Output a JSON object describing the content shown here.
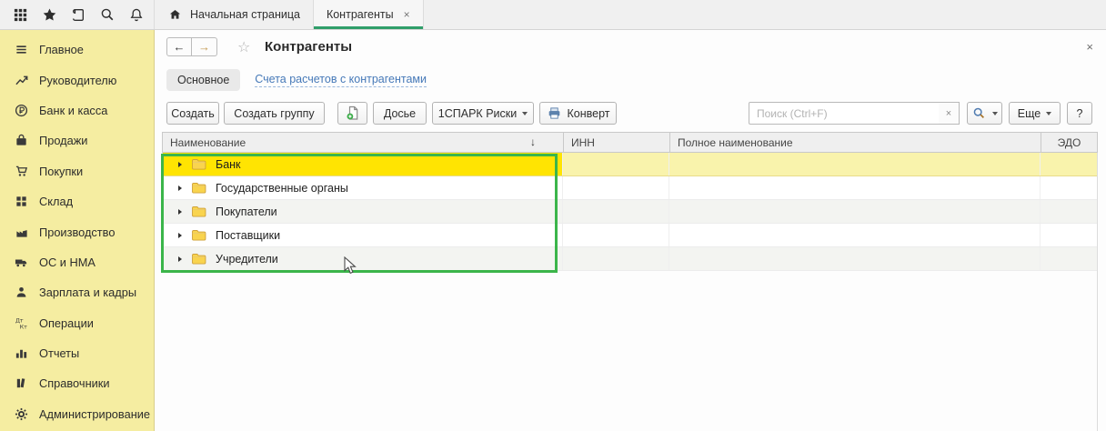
{
  "topbar": {
    "icons": [
      {
        "name": "apps-grid-icon"
      },
      {
        "name": "favorites-star-icon"
      },
      {
        "name": "history-icon"
      },
      {
        "name": "search-icon"
      },
      {
        "name": "notifications-bell-icon"
      }
    ],
    "tabs": [
      {
        "label": "Начальная страница",
        "icon": "home-icon",
        "active": false
      },
      {
        "label": "Контрагенты",
        "close": "×",
        "active": true
      }
    ]
  },
  "sidebar": {
    "items": [
      {
        "icon": "menu-icon",
        "label": "Главное"
      },
      {
        "icon": "trend-icon",
        "label": "Руководителю"
      },
      {
        "icon": "ruble-icon",
        "label": "Банк и касса"
      },
      {
        "icon": "bag-icon",
        "label": "Продажи"
      },
      {
        "icon": "cart-icon",
        "label": "Покупки"
      },
      {
        "icon": "boxes-icon",
        "label": "Склад"
      },
      {
        "icon": "factory-icon",
        "label": "Производство"
      },
      {
        "icon": "truck-icon",
        "label": "ОС и НМА"
      },
      {
        "icon": "person-icon",
        "label": "Зарплата и кадры"
      },
      {
        "icon": "dtkt-icon",
        "label": "Операции"
      },
      {
        "icon": "chart-icon",
        "label": "Отчеты"
      },
      {
        "icon": "books-icon",
        "label": "Справочники"
      },
      {
        "icon": "gear-icon",
        "label": "Администрирование"
      }
    ]
  },
  "form": {
    "back": "←",
    "forward": "→",
    "star": "☆",
    "title": "Контрагенты",
    "close": "×",
    "views": {
      "active": "Основное",
      "link": "Счета расчетов с контрагентами"
    },
    "toolbar": {
      "create": "Создать",
      "create_group": "Создать группу",
      "dossier": "Досье",
      "spark": "1СПАРК Риски",
      "envelope": "Конверт",
      "more": "Еще",
      "help": "?",
      "search_placeholder": "Поиск (Ctrl+F)",
      "search_value": "",
      "clear": "×"
    },
    "table": {
      "columns": [
        "Наименование",
        "ИНН",
        "Полное наименование",
        "ЭДО"
      ],
      "sort_indicator": "↓",
      "rows": [
        {
          "name": "Банк",
          "selected": true
        },
        {
          "name": "Государственные органы",
          "selected": false
        },
        {
          "name": "Покупатели",
          "selected": false
        },
        {
          "name": "Поставщики",
          "selected": false
        },
        {
          "name": "Учредители",
          "selected": false
        }
      ]
    }
  },
  "colors": {
    "active_tab_underline": "#2f9e69",
    "annotation_box": "#3bb54a",
    "selected_cell": "#ffe402",
    "selected_row": "#f9f3ac",
    "sidebar_bg": "#f5eda1",
    "link_blue": "#4679b8"
  }
}
